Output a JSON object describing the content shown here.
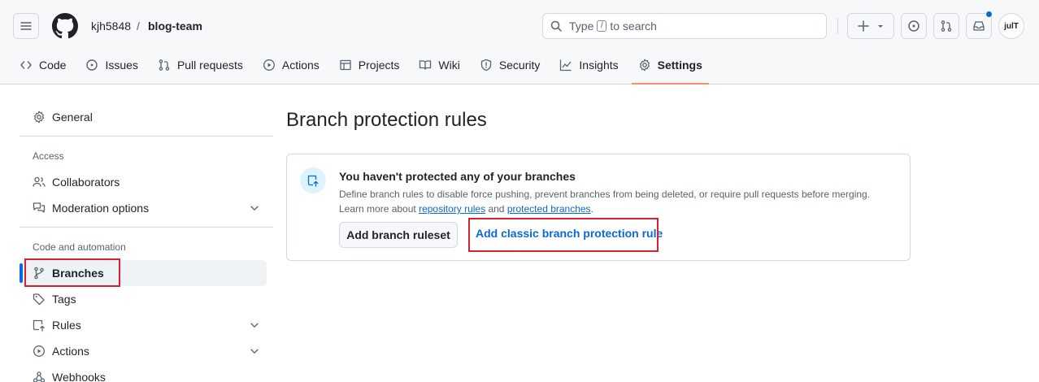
{
  "header": {
    "owner": "kjh5848",
    "separator": "/",
    "repo": "blog-team",
    "search": {
      "prefix": "Type",
      "key": "/",
      "suffix": "to search"
    },
    "avatar_text": "julT"
  },
  "tabs": [
    {
      "label": "Code",
      "icon": "code-icon"
    },
    {
      "label": "Issues",
      "icon": "issue-icon"
    },
    {
      "label": "Pull requests",
      "icon": "pull-request-icon"
    },
    {
      "label": "Actions",
      "icon": "play-icon"
    },
    {
      "label": "Projects",
      "icon": "table-icon"
    },
    {
      "label": "Wiki",
      "icon": "book-icon"
    },
    {
      "label": "Security",
      "icon": "shield-icon"
    },
    {
      "label": "Insights",
      "icon": "graph-icon"
    },
    {
      "label": "Settings",
      "icon": "gear-icon",
      "active": true
    }
  ],
  "sidebar": {
    "general": "General",
    "access_heading": "Access",
    "access_items": [
      "Collaborators",
      "Moderation options"
    ],
    "code_heading": "Code and automation",
    "code_items": [
      "Branches",
      "Tags",
      "Rules",
      "Actions",
      "Webhooks"
    ]
  },
  "main": {
    "title": "Branch protection rules",
    "blankslate": {
      "title": "You haven't protected any of your branches",
      "desc_line1": "Define branch rules to disable force pushing, prevent branches from being deleted, or require pull requests before merging.",
      "learn_prefix": "Learn more about",
      "link_repo_rules": "repository rules",
      "and": "and",
      "link_protected": "protected branches",
      "period": "."
    },
    "add_ruleset_button": "Add branch ruleset",
    "add_classic_button": "Add classic branch protection rule"
  },
  "colors": {
    "accent": "#0969da",
    "highlight": "#d1242f",
    "active_tab_underline": "#fd8c73"
  }
}
